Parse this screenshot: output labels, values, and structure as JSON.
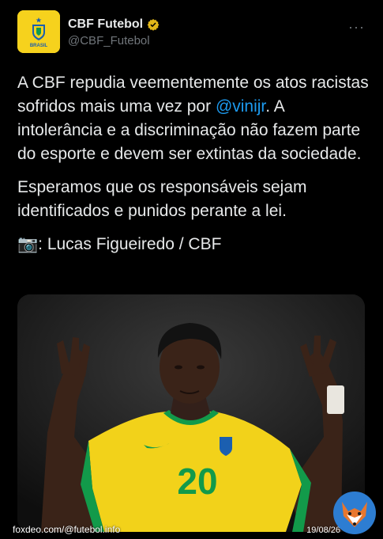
{
  "account": {
    "display_name": "CBF Futebol",
    "handle": "@CBF_Futebol",
    "avatar_text": "BRASIL",
    "verified": true
  },
  "more_label": "···",
  "tweet": {
    "paragraph1_text": "A CBF repudia veementemente os atos racistas sofridos mais uma vez por ",
    "paragraph1_mention": "@vinijr",
    "paragraph1_tail": ". A intolerância e a discriminação não fazem parte do esporte e devem ser extintas da sociedade.",
    "paragraph2": "Esperamos que os responsáveis sejam identificados e punidos perante a lei.",
    "photo_credit_icon": "📷",
    "photo_credit": ": Lucas Figueiredo / CBF"
  },
  "media": {
    "jersey_number": "20"
  },
  "watermark": {
    "left": "foxdeo.com/@futebol.info",
    "right": "19/08/26"
  },
  "colors": {
    "accent": "#1d9bf0",
    "cbf_yellow": "#f6d21d",
    "jersey_yellow": "#f2d21a",
    "jersey_green": "#129a4a"
  }
}
